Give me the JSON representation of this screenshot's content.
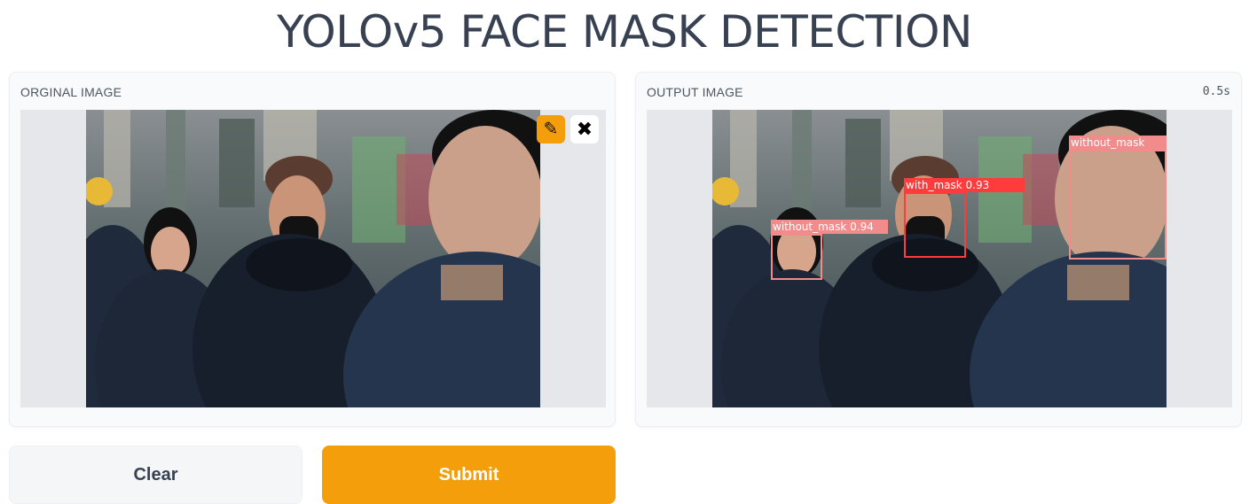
{
  "app": {
    "title": "YOLOv5 FACE MASK DETECTION"
  },
  "input_panel": {
    "label": "ORGINAL IMAGE",
    "edit_icon": "pencil-icon",
    "close_icon": "close-icon",
    "edit_glyph": "✎",
    "close_glyph": "✖"
  },
  "output_panel": {
    "label": "OUTPUT IMAGE",
    "timer": "0.5s",
    "detections": [
      {
        "label": "without_mask 0.94",
        "color": "#f28b8b"
      },
      {
        "label": "with_mask 0.93",
        "color": "#ff3b3b"
      },
      {
        "label": "without_mask",
        "color": "#f28b8b"
      }
    ]
  },
  "buttons": {
    "clear": "Clear",
    "submit": "Submit"
  },
  "colors": {
    "accent": "#f59e0b",
    "panel_bg": "#f9fafb",
    "image_bg": "#e5e7eb"
  }
}
